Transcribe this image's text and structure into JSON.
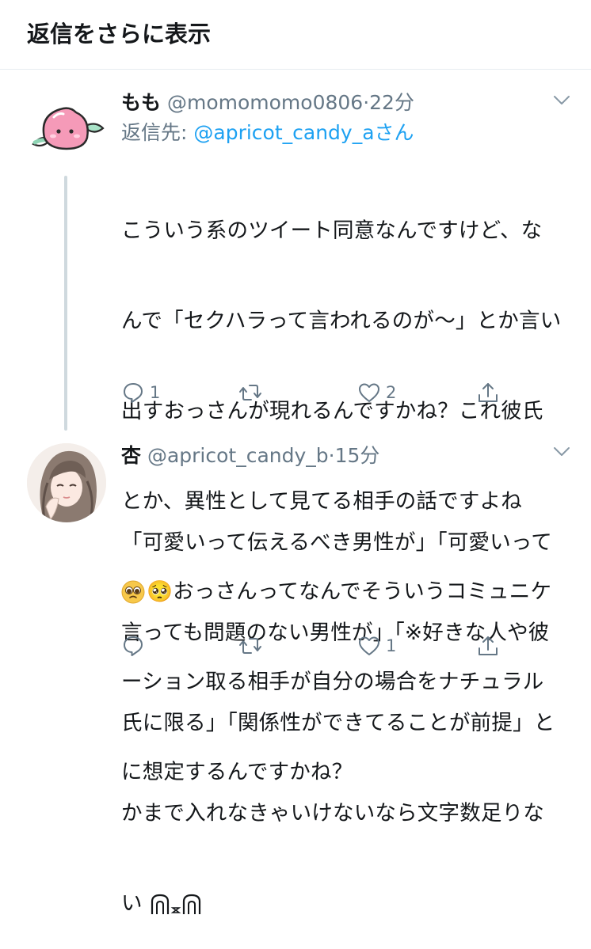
{
  "header": {
    "title": "返信をさらに表示"
  },
  "tweets": [
    {
      "name": "もも",
      "handle": "@momomomo0806",
      "dot": "·",
      "time": "22分",
      "reply_label": "返信先: ",
      "reply_mention": "@apricot_candy_a",
      "reply_suffix": "さん",
      "text_lines": [
        "こういう系のツイート同意なんですけど、な",
        "んで「セクハラって言われるのが〜」とか言い",
        "出すおっさんが現れるんですかね？これ彼氏",
        "とか、異性として見てる相手の話ですよね",
        "🥺おっさんってなんでそういうコミュニケ",
        "ーション取る相手が自分の場合をナチュラル",
        "に想定するんですかね？"
      ],
      "reply_count": "1",
      "retweet_count": "",
      "like_count": "2"
    },
    {
      "name": "杏",
      "handle": "@apricot_candy_b",
      "dot": "·",
      "time": "15分",
      "text_lines": [
        "「可愛いって伝えるべき男性が」「可愛いって",
        "言っても問題のない男性が」「※好きな人や彼",
        "氏に限る」「関係性ができてることが前提」と",
        "かまで入れなきゃいけないなら文字数足りな",
        "い "
      ],
      "reply_count": "",
      "retweet_count": "",
      "like_count": "1"
    }
  ],
  "icons": {
    "reply": "reply-icon",
    "retweet": "retweet-icon",
    "like": "heart-icon",
    "share": "share-icon",
    "more": "chevron-down-icon",
    "avatar1": "peach-avatar",
    "avatar2": "illustrated-portrait-avatar"
  },
  "colors": {
    "link": "#1da1f2",
    "secondary_text": "#657786",
    "thread_line": "#cfd9de",
    "peach": "#f59ab8",
    "leaf": "#8fd4b4"
  }
}
